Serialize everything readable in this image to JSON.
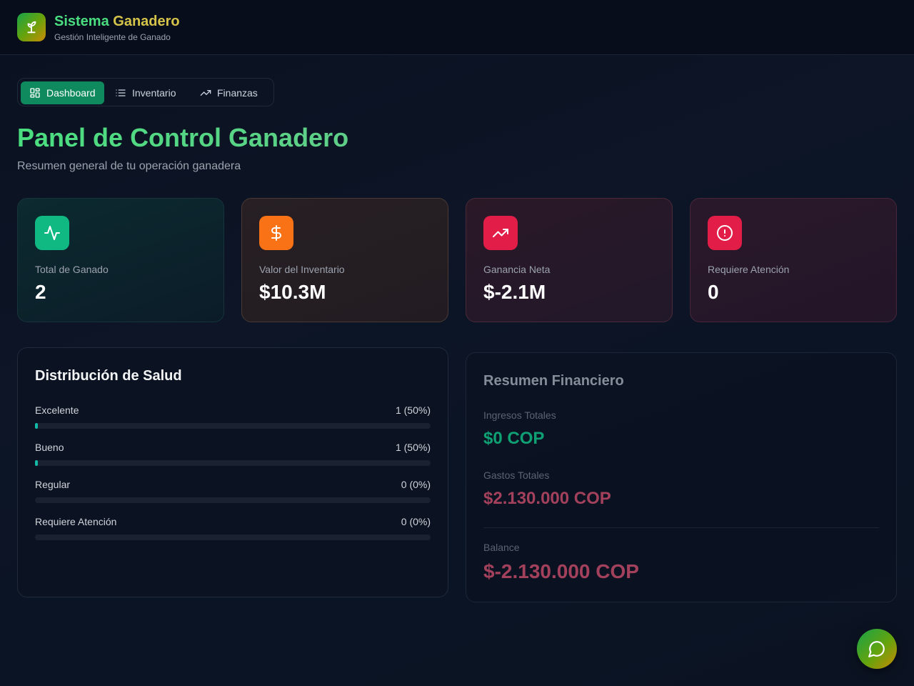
{
  "header": {
    "title_part1": "Sistema",
    "title_part2": "Ganadero",
    "subtitle": "Gestión Inteligente de Ganado",
    "logo_icon": "sprout-icon"
  },
  "nav": {
    "tabs": [
      {
        "label": "Dashboard",
        "icon": "dashboard-grid-icon",
        "active": true
      },
      {
        "label": "Inventario",
        "icon": "list-icon",
        "active": false
      },
      {
        "label": "Finanzas",
        "icon": "trending-up-icon",
        "active": false
      }
    ]
  },
  "page": {
    "title": "Panel de Control Ganadero",
    "subtitle": "Resumen general de tu operación ganadera"
  },
  "stats": [
    {
      "label": "Total de Ganado",
      "value": "2",
      "icon": "activity-icon",
      "color": "#10b981"
    },
    {
      "label": "Valor del Inventario",
      "value": "$10.3M",
      "icon": "dollar-icon",
      "color": "#f97316"
    },
    {
      "label": "Ganancia Neta",
      "value": "$-2.1M",
      "icon": "trending-up-icon",
      "color": "#e11d48"
    },
    {
      "label": "Requiere Atención",
      "value": "0",
      "icon": "alert-circle-icon",
      "color": "#e11d48"
    }
  ],
  "health": {
    "title": "Distribución de Salud",
    "rows": [
      {
        "label": "Excelente",
        "value": "1 (50%)",
        "percent": 50
      },
      {
        "label": "Bueno",
        "value": "1 (50%)",
        "percent": 50
      },
      {
        "label": "Regular",
        "value": "0 (0%)",
        "percent": 0
      },
      {
        "label": "Requiere Atención",
        "value": "0 (0%)",
        "percent": 0
      }
    ],
    "fill_color": "#14b8a6"
  },
  "finance": {
    "title": "Resumen Financiero",
    "income_label": "Ingresos Totales",
    "income_value": "$0 COP",
    "income_color": "#10b981",
    "expenses_label": "Gastos Totales",
    "expenses_value": "$2.130.000 COP",
    "expenses_color": "#be4a66",
    "balance_label": "Balance",
    "balance_value": "$-2.130.000 COP",
    "balance_color": "#be4a66"
  },
  "fab": {
    "icon": "chat-bubble-icon"
  }
}
